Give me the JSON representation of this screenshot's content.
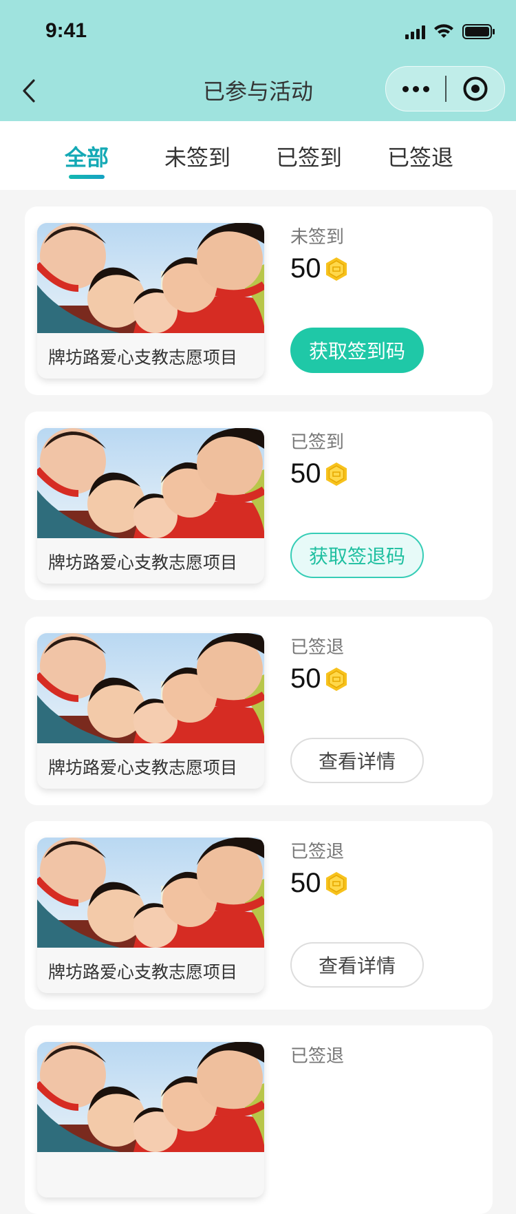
{
  "status_bar": {
    "time": "9:41"
  },
  "nav": {
    "title": "已参与活动"
  },
  "tabs": [
    {
      "label": "全部",
      "active": true
    },
    {
      "label": "未签到",
      "active": false
    },
    {
      "label": "已签到",
      "active": false
    },
    {
      "label": "已签退",
      "active": false
    }
  ],
  "colors": {
    "header": "#9fe3de",
    "accent": "#14a9b5",
    "button_primary": "#1fc8a7",
    "coin": "#f5c518"
  },
  "cards": [
    {
      "title": "牌坊路爱心支教志愿项目",
      "status": "未签到",
      "points": "50",
      "button": "获取签到码",
      "button_style": "primary"
    },
    {
      "title": "牌坊路爱心支教志愿项目",
      "status": "已签到",
      "points": "50",
      "button": "获取签退码",
      "button_style": "secondary"
    },
    {
      "title": "牌坊路爱心支教志愿项目",
      "status": "已签退",
      "points": "50",
      "button": "查看详情",
      "button_style": "outline"
    },
    {
      "title": "牌坊路爱心支教志愿项目",
      "status": "已签退",
      "points": "50",
      "button": "查看详情",
      "button_style": "outline"
    },
    {
      "title": "",
      "status": "已签退",
      "points": "",
      "button": "",
      "button_style": "outline"
    }
  ]
}
